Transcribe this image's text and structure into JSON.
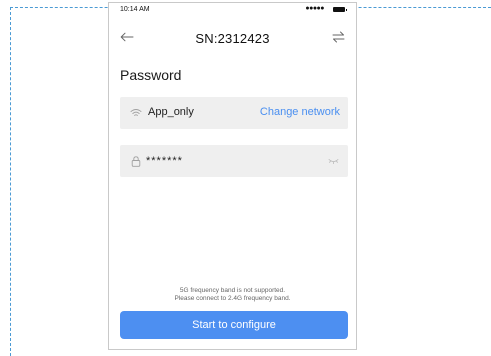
{
  "status_bar": {
    "time": "10:14 AM",
    "signal_icon": "signal-dots-icon",
    "battery_icon": "battery-icon"
  },
  "nav": {
    "title": "SN:2312423",
    "back_icon": "arrow-left-icon",
    "switch_icon": "swap-arrows-icon"
  },
  "section": {
    "title": "Password"
  },
  "network": {
    "icon": "wifi-icon",
    "name": "App_only",
    "change_label": "Change network"
  },
  "password": {
    "icon": "lock-icon",
    "value": "*******",
    "toggle_icon": "eye-closed-icon"
  },
  "notice": {
    "line1": "5G frequency band is not supported.",
    "line2": "Please connect to 2.4G frequency band."
  },
  "actions": {
    "configure_label": "Start to configure"
  },
  "colors": {
    "accent": "#4d8ff1",
    "link": "#4a8ff0",
    "field_bg": "#efefef",
    "frame_dash": "#4a9ad4"
  }
}
